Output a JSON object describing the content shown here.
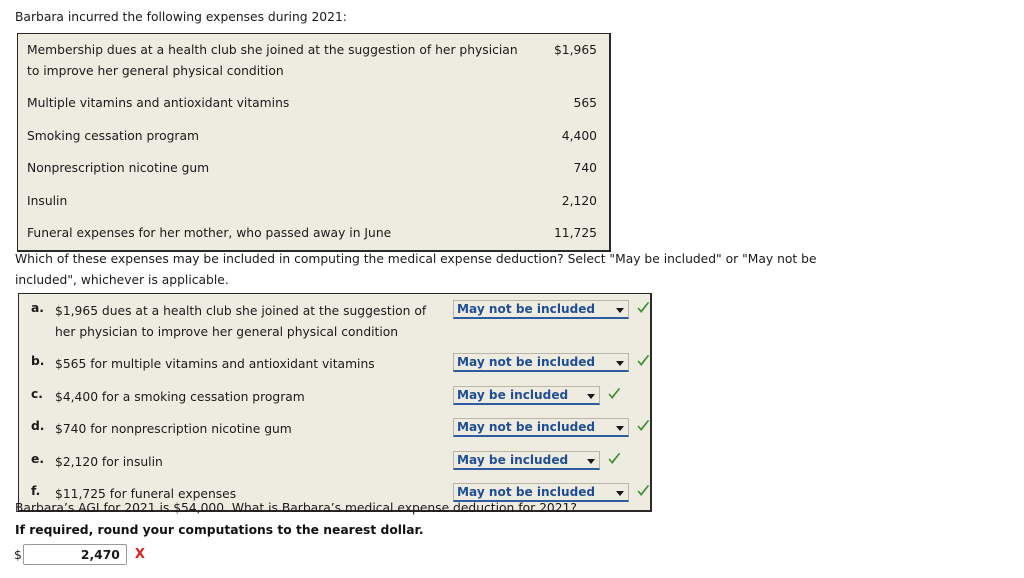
{
  "intro": "Barbara incurred the following expenses during 2021:",
  "expense_table": {
    "rows": [
      {
        "description": "Membership dues at a health club she joined at the suggestion of her physician to improve her general physical condition",
        "amount": "$1,965"
      },
      {
        "description": "Multiple vitamins and antioxidant vitamins",
        "amount": "565"
      },
      {
        "description": "Smoking cessation program",
        "amount": "4,400"
      },
      {
        "description": "Nonprescription nicotine gum",
        "amount": "740"
      },
      {
        "description": "Insulin",
        "amount": "2,120"
      },
      {
        "description": "Funeral expenses for her mother, who passed away in June",
        "amount": "11,725"
      }
    ]
  },
  "question": "Which of these expenses may be included in computing the medical expense deduction? Select \"May be included\" or \"May not be included\", whichever is applicable.",
  "answers": {
    "options": [
      "May be included",
      "May not be included"
    ],
    "rows": [
      {
        "label": "a.",
        "text": "$1,965 dues at a health club she joined at the suggestion of her physician to improve her general physical condition",
        "selected": "May not be included",
        "status": "correct"
      },
      {
        "label": "b.",
        "text": "$565 for multiple vitamins and antioxidant vitamins",
        "selected": "May not be included",
        "status": "correct"
      },
      {
        "label": "c.",
        "text": "$4,400 for a smoking cessation program",
        "selected": "May be included",
        "status": "correct"
      },
      {
        "label": "d.",
        "text": "$740 for nonprescription nicotine gum",
        "selected": "May not be included",
        "status": "correct"
      },
      {
        "label": "e.",
        "text": "$2,120 for insulin",
        "selected": "May be included",
        "status": "correct"
      },
      {
        "label": "f.",
        "text": "$11,725 for funeral expenses",
        "selected": "May not be included",
        "status": "correct"
      }
    ]
  },
  "bottom": {
    "agi_line": "Barbara’s AGI for 2021 is $54,000. What is Barbara’s medical expense deduction for 2021?",
    "round_line": "If required, round your computations to the nearest dollar.",
    "dollar_sign": "$",
    "answer_value": "2,470",
    "answer_placeholder": "",
    "wrong_mark": "X"
  },
  "colors": {
    "panel_bg": "#eeece0",
    "panel_border": "#2a2a28",
    "select_text": "#1f4e96",
    "select_underline": "#2f5c9e",
    "check_green": "#3f8f33",
    "wrong_red": "#e02020"
  }
}
